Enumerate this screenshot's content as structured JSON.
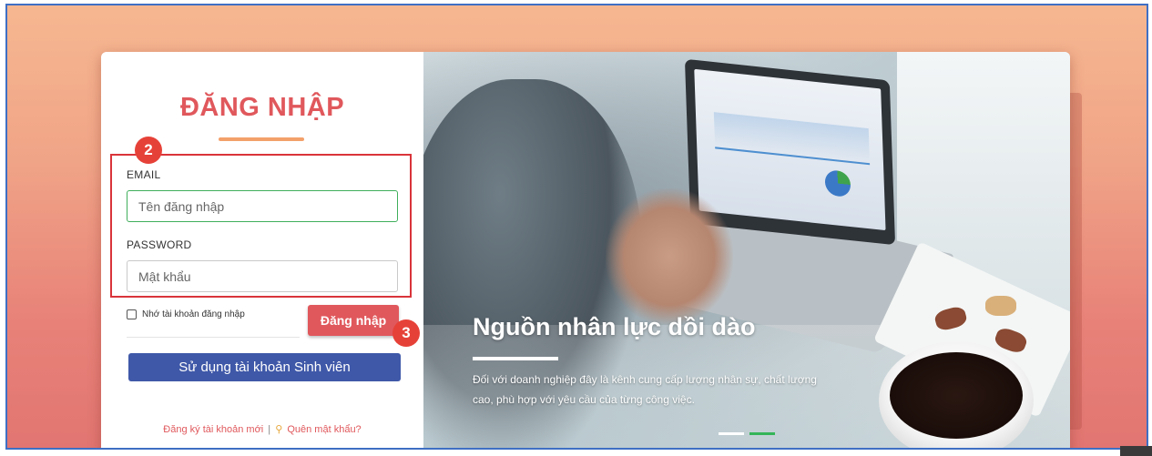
{
  "login": {
    "title": "ĐĂNG NHẬP",
    "email_label": "EMAIL",
    "email_placeholder": "Tên đăng nhập",
    "password_label": "PASSWORD",
    "password_placeholder": "Mật khẩu",
    "remember_label": "Nhớ tài khoản đăng nhập",
    "login_button": "Đăng nhập",
    "student_button": "Sử dụng tài khoản Sinh viên",
    "register_link": "Đăng ký tài khoản mới",
    "separator": "|",
    "forgot_link": "Quên mật khẩu?"
  },
  "annotations": {
    "step_2": "2",
    "step_3": "3"
  },
  "slide": {
    "title": "Nguồn nhân lực dồi dào",
    "description": "Đối với doanh nghiệp đây là kênh cung cấp lượng nhân sự, chất lượng cao, phù hợp với yêu cầu của từng công việc.",
    "total_slides": 2,
    "active_slide": 2
  },
  "colors": {
    "accent": "#e0585c",
    "student_button": "#3f58a8",
    "highlight_box": "#d9343a",
    "active_dot": "#35b558"
  },
  "icons": {
    "forgot": "key-icon"
  }
}
